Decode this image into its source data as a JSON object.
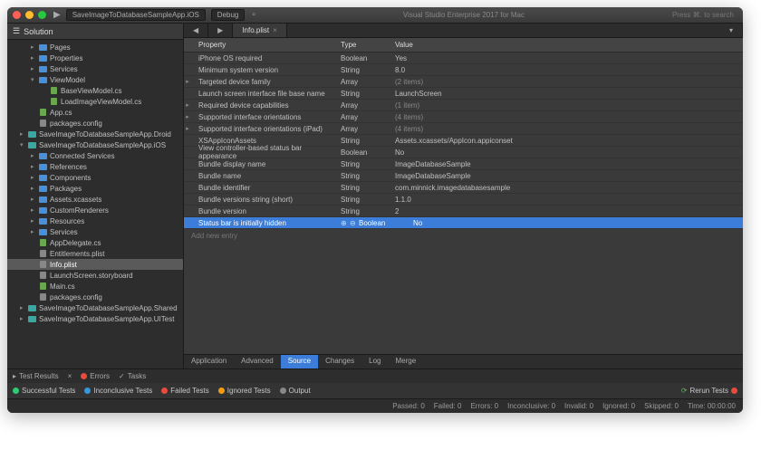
{
  "titlebar": {
    "project_combo": "SaveImageToDatabaseSampleApp.iOS",
    "config_combo": "Debug",
    "center_text": "Visual Studio Enterprise 2017 for Mac",
    "search_hint": "Press ⌘. to search"
  },
  "sidebar": {
    "title": "Solution",
    "items": [
      {
        "ind": 2,
        "arrow": "▸",
        "icon": "folder-blue",
        "label": "Pages"
      },
      {
        "ind": 2,
        "arrow": "▸",
        "icon": "folder-blue",
        "label": "Properties"
      },
      {
        "ind": 2,
        "arrow": "▸",
        "icon": "folder-blue",
        "label": "Services"
      },
      {
        "ind": 2,
        "arrow": "▾",
        "icon": "folder-blue",
        "label": "ViewModel"
      },
      {
        "ind": 3,
        "arrow": "",
        "icon": "file-cs",
        "label": "BaseViewModel.cs"
      },
      {
        "ind": 3,
        "arrow": "",
        "icon": "file-cs",
        "label": "LoadImageViewModel.cs"
      },
      {
        "ind": 2,
        "arrow": "",
        "icon": "file-cs",
        "label": "App.cs"
      },
      {
        "ind": 2,
        "arrow": "",
        "icon": "file-plist",
        "label": "packages.config"
      },
      {
        "ind": 1,
        "arrow": "▸",
        "icon": "folder-teal",
        "label": "SaveImageToDatabaseSampleApp.Droid"
      },
      {
        "ind": 1,
        "arrow": "▾",
        "icon": "folder-teal",
        "label": "SaveImageToDatabaseSampleApp.iOS"
      },
      {
        "ind": 2,
        "arrow": "▸",
        "icon": "folder-blue",
        "label": "Connected Services"
      },
      {
        "ind": 2,
        "arrow": "▸",
        "icon": "folder-blue",
        "label": "References"
      },
      {
        "ind": 2,
        "arrow": "▸",
        "icon": "folder-blue",
        "label": "Components"
      },
      {
        "ind": 2,
        "arrow": "▸",
        "icon": "folder-blue",
        "label": "Packages"
      },
      {
        "ind": 2,
        "arrow": "▸",
        "icon": "folder-blue",
        "label": "Assets.xcassets"
      },
      {
        "ind": 2,
        "arrow": "▸",
        "icon": "folder-blue",
        "label": "CustomRenderers"
      },
      {
        "ind": 2,
        "arrow": "▸",
        "icon": "folder-blue",
        "label": "Resources"
      },
      {
        "ind": 2,
        "arrow": "▸",
        "icon": "folder-blue",
        "label": "Services"
      },
      {
        "ind": 2,
        "arrow": "",
        "icon": "file-cs",
        "label": "AppDelegate.cs"
      },
      {
        "ind": 2,
        "arrow": "",
        "icon": "file-plist",
        "label": "Entitlements.plist"
      },
      {
        "ind": 2,
        "arrow": "",
        "icon": "file-plist",
        "label": "Info.plist",
        "selected": true
      },
      {
        "ind": 2,
        "arrow": "",
        "icon": "file-plist",
        "label": "LaunchScreen.storyboard"
      },
      {
        "ind": 2,
        "arrow": "",
        "icon": "file-cs",
        "label": "Main.cs"
      },
      {
        "ind": 2,
        "arrow": "",
        "icon": "file-plist",
        "label": "packages.config"
      },
      {
        "ind": 1,
        "arrow": "▸",
        "icon": "folder-teal",
        "label": "SaveImageToDatabaseSampleApp.Shared"
      },
      {
        "ind": 1,
        "arrow": "▸",
        "icon": "folder-teal",
        "label": "SaveImageToDatabaseSampleApp.UITest"
      }
    ]
  },
  "editor": {
    "tab_back": "◀",
    "tab_fwd": "▶",
    "tab_label": "Info.plist",
    "headers": {
      "prop": "Property",
      "type": "Type",
      "value": "Value"
    },
    "rows": [
      {
        "arrow": "",
        "prop": "iPhone OS required",
        "type": "Boolean",
        "val": "Yes"
      },
      {
        "arrow": "",
        "prop": "Minimum system version",
        "type": "String",
        "val": "8.0"
      },
      {
        "arrow": "▸",
        "prop": "Targeted device family",
        "type": "Array",
        "val": "(2 items)"
      },
      {
        "arrow": "",
        "prop": "Launch screen interface file base name",
        "type": "String",
        "val": "LaunchScreen"
      },
      {
        "arrow": "▸",
        "prop": "Required device capabilities",
        "type": "Array",
        "val": "(1 item)"
      },
      {
        "arrow": "▸",
        "prop": "Supported interface orientations",
        "type": "Array",
        "val": "(4 items)"
      },
      {
        "arrow": "▸",
        "prop": "Supported interface orientations (iPad)",
        "type": "Array",
        "val": "(4 items)"
      },
      {
        "arrow": "",
        "prop": "XSAppIconAssets",
        "type": "String",
        "val": "Assets.xcassets/AppIcon.appiconset"
      },
      {
        "arrow": "",
        "prop": "View controller-based status bar appearance",
        "type": "Boolean",
        "val": "No"
      },
      {
        "arrow": "",
        "prop": "Bundle display name",
        "type": "String",
        "val": "ImageDatabaseSample"
      },
      {
        "arrow": "",
        "prop": "Bundle name",
        "type": "String",
        "val": "ImageDatabaseSample"
      },
      {
        "arrow": "",
        "prop": "Bundle identifier",
        "type": "String",
        "val": "com.minnick.imagedatabasesample"
      },
      {
        "arrow": "",
        "prop": "Bundle versions string (short)",
        "type": "String",
        "val": "1.1.0"
      },
      {
        "arrow": "",
        "prop": "Bundle version",
        "type": "String",
        "val": "2"
      },
      {
        "arrow": "",
        "prop": "Status bar is initially hidden",
        "type": "Boolean",
        "val": "No",
        "selected": true
      }
    ],
    "add_entry": "Add new entry",
    "bottom_tabs": [
      "Application",
      "Advanced",
      "Source",
      "Changes",
      "Log",
      "Merge"
    ],
    "active_btab": 2
  },
  "bottom_panel": {
    "row1": {
      "test_results": "Test Results",
      "errors": "Errors",
      "tasks": "Tasks"
    },
    "pills": [
      {
        "color": "b-green",
        "label": "Successful Tests"
      },
      {
        "color": "b-blue",
        "label": "Inconclusive Tests"
      },
      {
        "color": "b-red",
        "label": "Failed Tests"
      },
      {
        "color": "b-orange",
        "label": "Ignored Tests"
      },
      {
        "color": "b-gray",
        "label": "Output"
      }
    ],
    "rerun": "Rerun Tests"
  },
  "status": {
    "passed": "Passed: 0",
    "failed": "Failed: 0",
    "errors": "Errors: 0",
    "inconclusive": "Inconclusive: 0",
    "invalid": "Invalid: 0",
    "ignored": "Ignored: 0",
    "skipped": "Skipped: 0",
    "time": "Time: 00:00:00"
  }
}
